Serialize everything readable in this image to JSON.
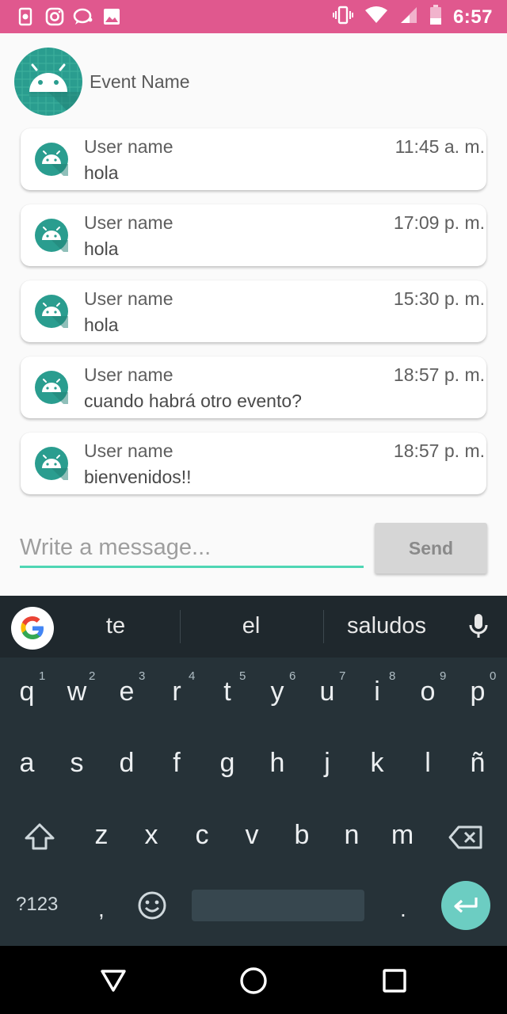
{
  "status_bar": {
    "time": "6:57",
    "left_icons": [
      "phone-settings-icon",
      "instagram-icon",
      "chat-bubble-icon",
      "image-icon"
    ],
    "right_icons": [
      "vibrate-icon",
      "wifi-icon",
      "cell-signal-icon",
      "battery-icon"
    ],
    "color": "#e0588e"
  },
  "header": {
    "title": "Event Name",
    "avatar": "android-avatar-icon"
  },
  "messages": [
    {
      "user": "User name",
      "time": "11:45 a. m.",
      "text": "hola"
    },
    {
      "user": "User name",
      "time": "17:09 p. m.",
      "text": "hola"
    },
    {
      "user": "User name",
      "time": "15:30 p. m.",
      "text": "hola"
    },
    {
      "user": "User name",
      "time": "18:57 p. m.",
      "text": "cuando habrá otro evento?"
    },
    {
      "user": "User name",
      "time": "18:57 p. m.",
      "text": "bienvenidos!!"
    }
  ],
  "composer": {
    "placeholder": "Write a message...",
    "value": "",
    "send_label": "Send",
    "accent": "#4fd6b4"
  },
  "keyboard": {
    "suggestions": [
      "te",
      "el",
      "saludos"
    ],
    "row1": [
      "q",
      "w",
      "e",
      "r",
      "t",
      "y",
      "u",
      "i",
      "o",
      "p"
    ],
    "row1_hints": [
      "1",
      "2",
      "3",
      "4",
      "5",
      "6",
      "7",
      "8",
      "9",
      "0"
    ],
    "row2": [
      "a",
      "s",
      "d",
      "f",
      "g",
      "h",
      "j",
      "k",
      "l",
      "ñ"
    ],
    "row3": [
      "z",
      "x",
      "c",
      "v",
      "b",
      "n",
      "m"
    ],
    "symbols_label": "?123",
    "comma": ",",
    "period": ".",
    "enter_color": "#6ccdc2"
  },
  "nav_bar": {
    "buttons": [
      "back-icon",
      "home-icon",
      "recents-icon"
    ]
  }
}
